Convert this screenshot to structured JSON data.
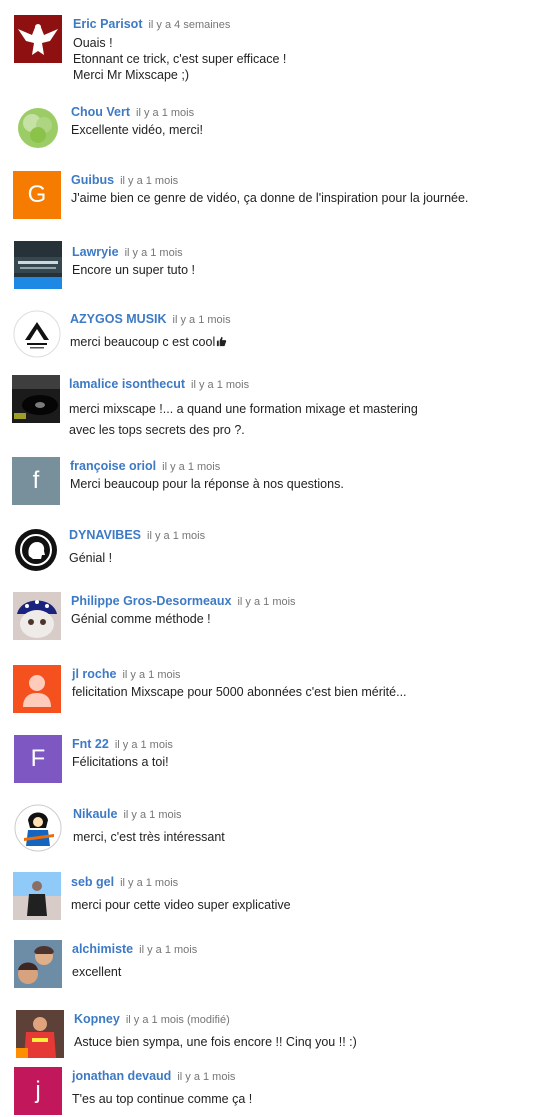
{
  "comments": [
    {
      "author": "Eric Parisot",
      "time": "il y a 4 semaines",
      "lines": [
        "Ouais !",
        "Etonnant ce trick, c'est super efficace !",
        "Merci Mr Mixscape ;)"
      ],
      "avatar": "eagle-icon"
    },
    {
      "author": "Chou Vert",
      "time": "il y a 1 mois",
      "lines": [
        "Excellente vidéo, merci!"
      ],
      "avatar": "cabbage-icon"
    },
    {
      "author": "Guibus",
      "time": "il y a 1 mois",
      "lines": [
        "J'aime bien ce genre de vidéo, ça donne de l'inspiration pour la journée."
      ],
      "avatar_letter": "G",
      "avatar_color": "#f57c00"
    },
    {
      "author": "Lawryie",
      "time": "il y a 1 mois",
      "lines": [
        "Encore un super tuto !"
      ],
      "avatar": "photo-avatar"
    },
    {
      "author": "AZYGOS MUSIK",
      "time": "il y a 1 mois",
      "lines": [
        "merci beaucoup c est cool"
      ],
      "emoji": "thumbs-up-icon",
      "avatar": "azygos-logo"
    },
    {
      "author": "lamalice isonthecut",
      "time": "il y a 1 mois",
      "lines": [
        "merci mixscape !... a quand une formation mixage et mastering",
        "avec les tops secrets des pro ?."
      ],
      "avatar": "turntable-photo"
    },
    {
      "author": "françoise oriol",
      "time": "il y a 1 mois",
      "lines": [
        "Merci beaucoup pour la réponse à nos questions."
      ],
      "avatar_letter": "f",
      "avatar_color": "#78909c"
    },
    {
      "author": "DYNAVIBES",
      "time": "il y a 1 mois",
      "lines": [
        "Génial !"
      ],
      "avatar": "dynavibes-logo"
    },
    {
      "author": "Philippe Gros-Desormeaux",
      "time": "il y a 1 mois",
      "lines": [
        "Génial comme méthode !"
      ],
      "avatar": "cat-photo"
    },
    {
      "author": "jl roche",
      "time": "il y a 1 mois",
      "lines": [
        "felicitation Mixscape pour 5000 abonnées c'est bien mérité..."
      ],
      "avatar": "default-user-icon",
      "avatar_color": "#f4511e"
    },
    {
      "author": "Fnt 22",
      "time": "il y a 1 mois",
      "lines": [
        "Félicitations a toi!"
      ],
      "avatar_letter": "F",
      "avatar_color": "#7e57c2"
    },
    {
      "author": "Nikaule",
      "time": "il y a 1 mois",
      "lines": [
        "merci, c'est très intéressant"
      ],
      "avatar": "guitarist-drawing"
    },
    {
      "author": "seb gel",
      "time": "il y a 1 mois",
      "lines": [
        "merci pour cette video super explicative"
      ],
      "avatar": "beach-photo"
    },
    {
      "author": "alchimiste",
      "time": "il y a 1 mois",
      "lines": [
        "excellent"
      ],
      "avatar": "couple-photo"
    },
    {
      "author": "Kopney",
      "time": "il y a 1 mois (modifié)",
      "lines": [
        "Astuce bien sympa, une fois encore !! Cinq you !! :)"
      ],
      "avatar": "team-photo"
    },
    {
      "author": "jonathan devaud",
      "time": "il y a 1 mois",
      "lines": [
        "T'es au top continue comme ça !"
      ],
      "avatar_letter": "j",
      "avatar_color": "#c2185b"
    }
  ]
}
